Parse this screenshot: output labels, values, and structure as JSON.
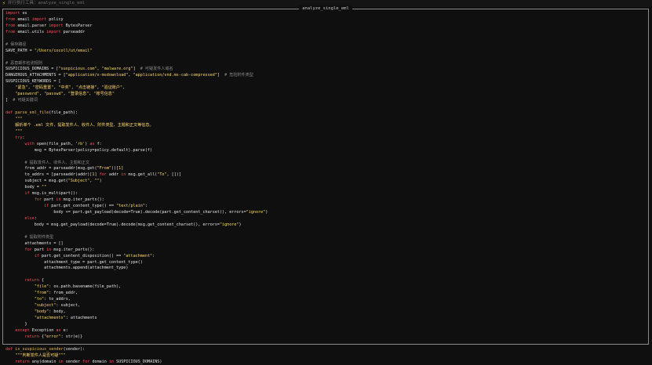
{
  "header": {
    "icon": "lightning-icon",
    "label": "并行执行工具：analyze_single_eml"
  },
  "panel": {
    "title": "analyze_single_eml"
  },
  "code_lines": [
    [
      [
        "kw",
        "import"
      ],
      [
        "tx",
        " os"
      ]
    ],
    [
      [
        "kw",
        "from"
      ],
      [
        "tx",
        " email "
      ],
      [
        "kw",
        "import"
      ],
      [
        "tx",
        " policy"
      ]
    ],
    [
      [
        "kw",
        "from"
      ],
      [
        "tx",
        " email.parser "
      ],
      [
        "kw",
        "import"
      ],
      [
        "tx",
        " BytesParser"
      ]
    ],
    [
      [
        "kw",
        "from"
      ],
      [
        "tx",
        " email.utils "
      ],
      [
        "kw",
        "import"
      ],
      [
        "tx",
        " parseaddr"
      ]
    ],
    [],
    [
      [
        "cm",
        "# 保存路径"
      ]
    ],
    [
      [
        "tx",
        "SAVE_PATH = "
      ],
      [
        "st",
        "\"/Users/cocoll/ut/email\""
      ]
    ],
    [],
    [
      [
        "cm",
        "# 恶意邮件检测规则"
      ]
    ],
    [
      [
        "tx",
        "SUSPICIOUS_DOMAINS = ["
      ],
      [
        "st",
        "\"suspicious.com\""
      ],
      [
        "tx",
        ", "
      ],
      [
        "st",
        "\"malware.org\""
      ],
      [
        "tx",
        "]  "
      ],
      [
        "cm",
        "# 可疑发件人域名"
      ]
    ],
    [
      [
        "tx",
        "DANGEROUS_ATTACHMENTS = ["
      ],
      [
        "st",
        "\"application/x-msdownload\""
      ],
      [
        "tx",
        ", "
      ],
      [
        "st",
        "\"application/vnd.ms-cab-compressed\""
      ],
      [
        "tx",
        "]  "
      ],
      [
        "cm",
        "# 危险附件类型"
      ]
    ],
    [
      [
        "tx",
        "SUSPICIOUS_KEYWORDS = ["
      ]
    ],
    [
      [
        "tx",
        "    "
      ],
      [
        "st",
        "\"紧急\""
      ],
      [
        "tx",
        ", "
      ],
      [
        "st",
        "\"密码重置\""
      ],
      [
        "tx",
        ", "
      ],
      [
        "st",
        "\"中奖\""
      ],
      [
        "tx",
        ", "
      ],
      [
        "st",
        "\"点击链接\""
      ],
      [
        "tx",
        ", "
      ],
      [
        "st",
        "\"验证账户\""
      ],
      [
        "tx",
        ","
      ]
    ],
    [
      [
        "tx",
        "    "
      ],
      [
        "st",
        "\"password\""
      ],
      [
        "tx",
        ", "
      ],
      [
        "st",
        "\"passwd\""
      ],
      [
        "tx",
        ", "
      ],
      [
        "st",
        "\"登录信息\""
      ],
      [
        "tx",
        ", "
      ],
      [
        "st",
        "\"账号信息\""
      ]
    ],
    [
      [
        "tx",
        "]  "
      ],
      [
        "cm",
        "# 可疑关键词"
      ]
    ],
    [],
    [
      [
        "kw",
        "def"
      ],
      [
        "tx",
        " "
      ],
      [
        "fn",
        "parse_eml_file"
      ],
      [
        "tx",
        "(file_path):"
      ]
    ],
    [
      [
        "tx",
        "    "
      ],
      [
        "st",
        "\"\"\""
      ]
    ],
    [
      [
        "tx",
        "    "
      ],
      [
        "st",
        "解析单个 .eml 文件，提取发件人、收件人、附件类型、主题和正文等信息。"
      ]
    ],
    [
      [
        "tx",
        "    "
      ],
      [
        "st",
        "\"\"\""
      ]
    ],
    [
      [
        "tx",
        "    "
      ],
      [
        "kw",
        "try"
      ],
      [
        "tx",
        ":"
      ]
    ],
    [
      [
        "tx",
        "        "
      ],
      [
        "kw",
        "with"
      ],
      [
        "tx",
        " open(file_path, "
      ],
      [
        "st",
        "'rb'"
      ],
      [
        "tx",
        ") "
      ],
      [
        "kw",
        "as"
      ],
      [
        "tx",
        " f:"
      ]
    ],
    [
      [
        "tx",
        "            msg = BytesParser(policy=policy.default).parse(f)"
      ]
    ],
    [],
    [
      [
        "tx",
        "        "
      ],
      [
        "cm",
        "# 提取发件人、收件人、主题和正文"
      ]
    ],
    [
      [
        "tx",
        "        from_addr = parseaddr(msg.get("
      ],
      [
        "st",
        "\"From\""
      ],
      [
        "tx",
        "))["
      ],
      [
        "st",
        "1"
      ],
      [
        "tx",
        "]"
      ]
    ],
    [
      [
        "tx",
        "        to_addrs = [parseaddr(addr)["
      ],
      [
        "st",
        "1"
      ],
      [
        "tx",
        "] "
      ],
      [
        "kw",
        "for"
      ],
      [
        "tx",
        " addr "
      ],
      [
        "kw",
        "in"
      ],
      [
        "tx",
        " msg.get_all("
      ],
      [
        "st",
        "\"To\""
      ],
      [
        "tx",
        ", [])]"
      ]
    ],
    [
      [
        "tx",
        "        subject = msg.get("
      ],
      [
        "st",
        "\"Subject\""
      ],
      [
        "tx",
        ", "
      ],
      [
        "st",
        "\"\""
      ],
      [
        "tx",
        ")"
      ]
    ],
    [
      [
        "tx",
        "        body = "
      ],
      [
        "st",
        "\"\""
      ]
    ],
    [
      [
        "tx",
        "        "
      ],
      [
        "kw",
        "if"
      ],
      [
        "tx",
        " msg.is_multipart():"
      ]
    ],
    [
      [
        "tx",
        "            "
      ],
      [
        "kw",
        "for"
      ],
      [
        "tx",
        " part "
      ],
      [
        "kw",
        "in"
      ],
      [
        "tx",
        " msg.iter_parts():"
      ]
    ],
    [
      [
        "tx",
        "                "
      ],
      [
        "kw",
        "if"
      ],
      [
        "tx",
        " part.get_content_type() == "
      ],
      [
        "st",
        "\"text/plain\""
      ],
      [
        "tx",
        ":"
      ]
    ],
    [
      [
        "tx",
        "                    body += part.get_payload(decode="
      ],
      [
        "ct",
        "True"
      ],
      [
        "tx",
        ").decode(part.get_content_charset(), errors="
      ],
      [
        "st",
        "\"ignore\""
      ],
      [
        "tx",
        ")"
      ]
    ],
    [
      [
        "tx",
        "        "
      ],
      [
        "kw",
        "else"
      ],
      [
        "tx",
        ":"
      ]
    ],
    [
      [
        "tx",
        "            body = msg.get_payload(decode="
      ],
      [
        "ct",
        "True"
      ],
      [
        "tx",
        ").decode(msg.get_content_charset(), errors="
      ],
      [
        "st",
        "\"ignore\""
      ],
      [
        "tx",
        ")"
      ]
    ],
    [],
    [
      [
        "tx",
        "        "
      ],
      [
        "cm",
        "# 提取附件类型"
      ]
    ],
    [
      [
        "tx",
        "        attachments = []"
      ]
    ],
    [
      [
        "tx",
        "        "
      ],
      [
        "kw",
        "for"
      ],
      [
        "tx",
        " part "
      ],
      [
        "kw",
        "in"
      ],
      [
        "tx",
        " msg.iter_parts():"
      ]
    ],
    [
      [
        "tx",
        "            "
      ],
      [
        "kw",
        "if"
      ],
      [
        "tx",
        " part.get_content_disposition() == "
      ],
      [
        "st",
        "\"attachment\""
      ],
      [
        "tx",
        ":"
      ]
    ],
    [
      [
        "tx",
        "                attachment_type = part.get_content_type()"
      ]
    ],
    [
      [
        "tx",
        "                attachments.append(attachment_type)"
      ]
    ],
    [],
    [
      [
        "tx",
        "        "
      ],
      [
        "kw",
        "return"
      ],
      [
        "tx",
        " {"
      ]
    ],
    [
      [
        "tx",
        "            "
      ],
      [
        "st",
        "\"file\""
      ],
      [
        "tx",
        ": os.path.basename(file_path),"
      ]
    ],
    [
      [
        "tx",
        "            "
      ],
      [
        "st",
        "\"from\""
      ],
      [
        "tx",
        ": from_addr,"
      ]
    ],
    [
      [
        "tx",
        "            "
      ],
      [
        "st",
        "\"to\""
      ],
      [
        "tx",
        ": to_addrs,"
      ]
    ],
    [
      [
        "tx",
        "            "
      ],
      [
        "st",
        "\"subject\""
      ],
      [
        "tx",
        ": subject,"
      ]
    ],
    [
      [
        "tx",
        "            "
      ],
      [
        "st",
        "\"body\""
      ],
      [
        "tx",
        ": body,"
      ]
    ],
    [
      [
        "tx",
        "            "
      ],
      [
        "st",
        "\"attachments\""
      ],
      [
        "tx",
        ": attachments"
      ]
    ],
    [
      [
        "tx",
        "        }"
      ]
    ],
    [
      [
        "tx",
        "    "
      ],
      [
        "kw",
        "except"
      ],
      [
        "tx",
        " Exception "
      ],
      [
        "kw",
        "as"
      ],
      [
        "tx",
        " e:"
      ]
    ],
    [
      [
        "tx",
        "        "
      ],
      [
        "kw",
        "return"
      ],
      [
        "tx",
        " {"
      ],
      [
        "st",
        "\"error\""
      ],
      [
        "tx",
        ": str(e)}"
      ]
    ],
    [],
    [
      [
        "kw",
        "def"
      ],
      [
        "tx",
        " "
      ],
      [
        "fn",
        "is_suspicious_sender"
      ],
      [
        "tx",
        "(sender):"
      ]
    ],
    [
      [
        "tx",
        "    "
      ],
      [
        "st",
        "\"\"\"判断发件人是否可疑\"\"\""
      ]
    ],
    [
      [
        "tx",
        "    "
      ],
      [
        "kw",
        "return"
      ],
      [
        "tx",
        " any(domain "
      ],
      [
        "kw",
        "in"
      ],
      [
        "tx",
        " sender "
      ],
      [
        "kw",
        "for"
      ],
      [
        "tx",
        " domain "
      ],
      [
        "kw",
        "in"
      ],
      [
        "tx",
        " SUSPICIOUS_DOMAINS)"
      ]
    ]
  ]
}
